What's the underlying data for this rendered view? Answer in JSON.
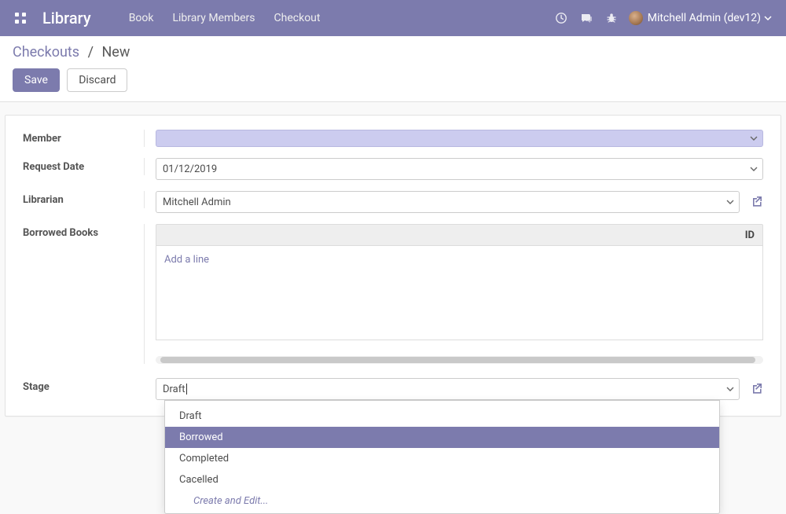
{
  "navbar": {
    "app_title": "Library",
    "menu": [
      "Book",
      "Library Members",
      "Checkout"
    ],
    "user_label": "Mitchell Admin (dev12)"
  },
  "breadcrumb": {
    "root": "Checkouts",
    "sep": "/",
    "current": "New"
  },
  "buttons": {
    "save": "Save",
    "discard": "Discard"
  },
  "form": {
    "labels": {
      "member": "Member",
      "request_date": "Request Date",
      "librarian": "Librarian",
      "borrowed_books": "Borrowed Books",
      "stage": "Stage"
    },
    "member_value": "",
    "request_date_value": "01/12/2019",
    "librarian_value": "Mitchell Admin",
    "list_header_col": "ID",
    "add_line": "Add a line",
    "stage_value": "Draft"
  },
  "stage_dropdown": {
    "options": [
      "Draft",
      "Borrowed",
      "Completed",
      "Cacelled"
    ],
    "active_index": 1,
    "create_edit": "Create and Edit..."
  }
}
